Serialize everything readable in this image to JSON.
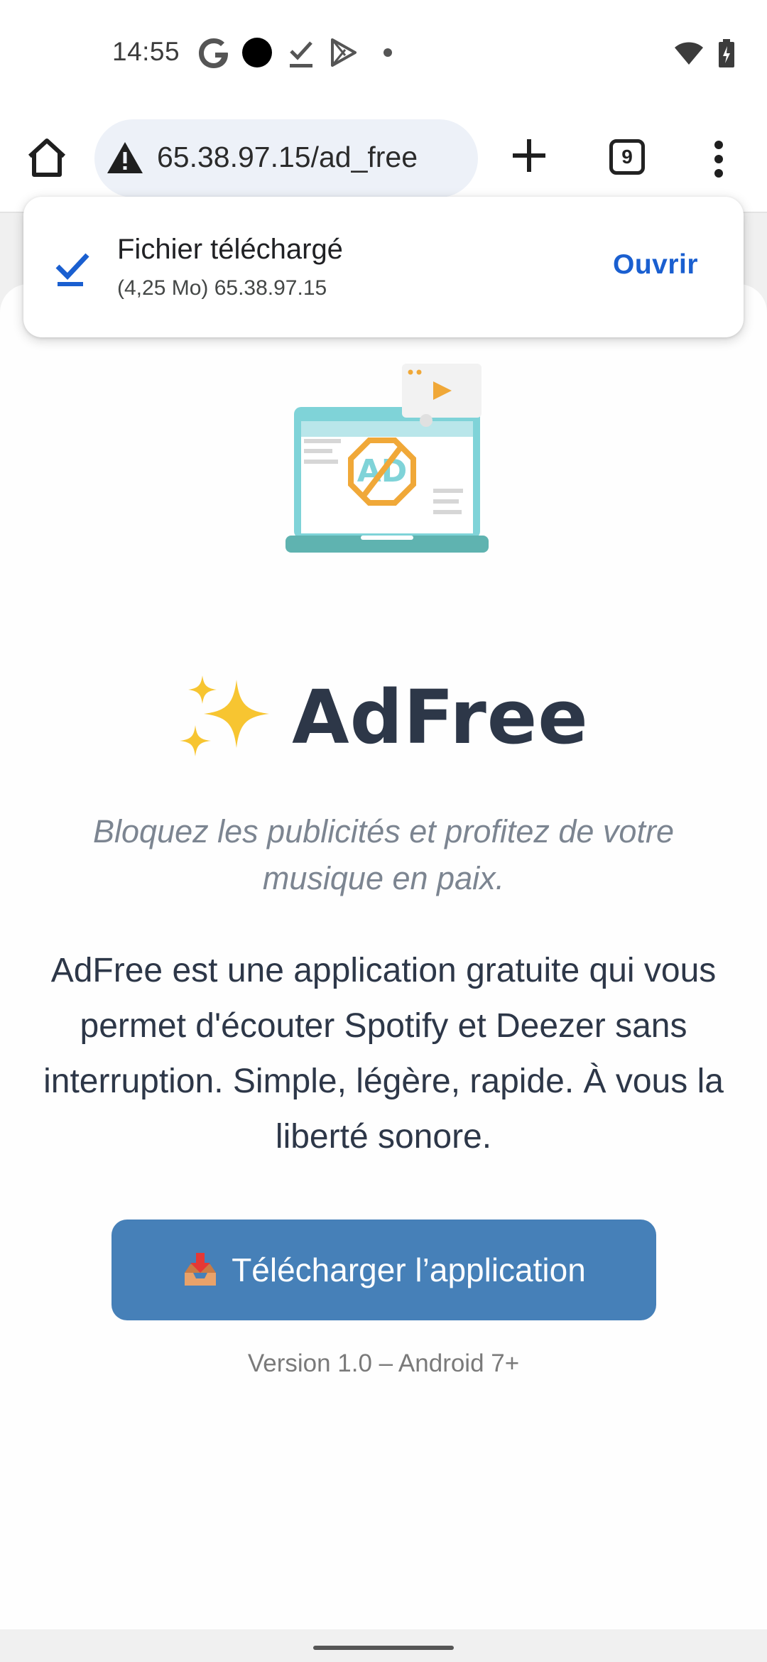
{
  "status_bar": {
    "time": "14:55",
    "notification_icons": [
      "google-g-icon",
      "black-circle-icon",
      "download-done-icon",
      "play-store-icon",
      "dot-icon"
    ],
    "system_icons": [
      "wifi-icon",
      "battery-charging-icon"
    ]
  },
  "browser": {
    "url": "65.38.97.15/ad_free",
    "tab_count": "9"
  },
  "snackbar": {
    "title": "Fichier téléchargé",
    "subtitle": "(4,25 Mo) 65.38.97.15",
    "action": "Ouvrir"
  },
  "page": {
    "title_emoji": "sparkles-icon",
    "title": "AdFree",
    "tagline": "Bloquez les publicités et profitez de votre musique en paix.",
    "description": "AdFree est une application gratuite qui vous permet d'écouter Spotify et Deezer sans interruption. Simple, légère, rapide. À vous la liberté sonore.",
    "download_label": "Télécharger l’application",
    "version": "Version 1.0 – Android 7+",
    "hero_ad_text": "AD"
  },
  "colors": {
    "button": "#4680b8",
    "title": "#2d3748",
    "link": "#1a5fd0",
    "hero_teal": "#7fd3d8",
    "hero_orange": "#f0a838"
  }
}
